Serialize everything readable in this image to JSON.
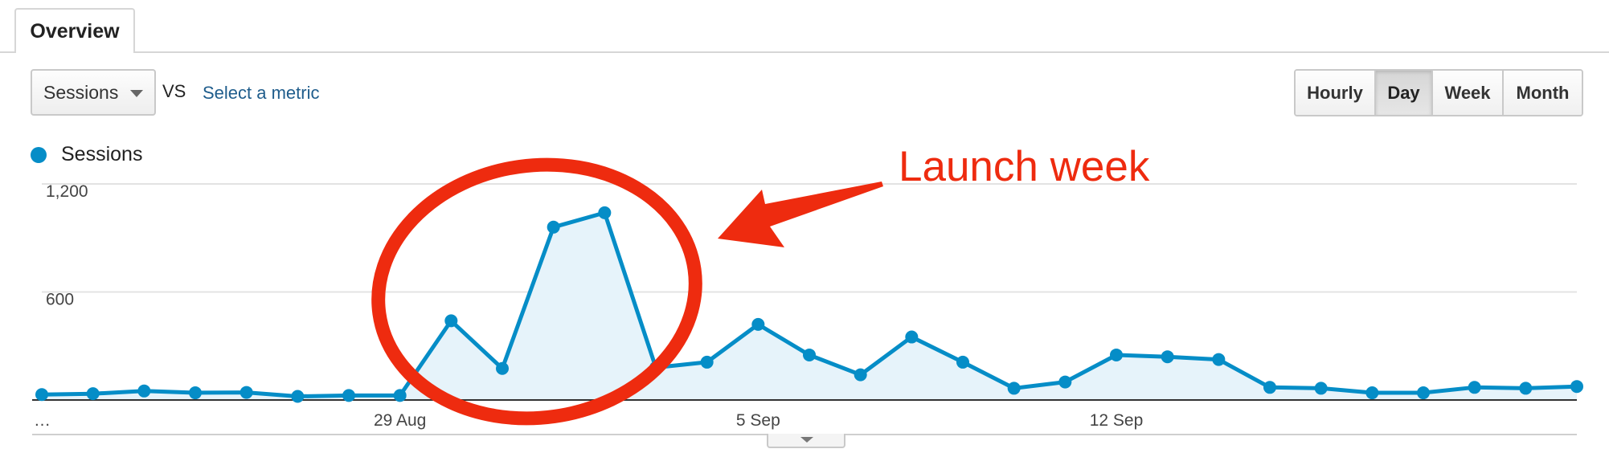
{
  "tabs": [
    {
      "label": "Overview",
      "active": true
    }
  ],
  "controls": {
    "metric_select": {
      "value": "Sessions"
    },
    "vs_label": "VS",
    "compare_link": "Select a metric",
    "granularity": [
      {
        "label": "Hourly",
        "active": false
      },
      {
        "label": "Day",
        "active": true
      },
      {
        "label": "Week",
        "active": false
      },
      {
        "label": "Month",
        "active": false
      }
    ]
  },
  "legend": {
    "label": "Sessions",
    "color": "#058dc7"
  },
  "annotation": {
    "text": "Launch week",
    "color": "#ee2b0f"
  },
  "chart_data": {
    "type": "area",
    "series": [
      {
        "name": "Sessions",
        "color": "#058dc7",
        "values": [
          30,
          35,
          50,
          40,
          42,
          20,
          25,
          25,
          440,
          175,
          960,
          1040,
          180,
          210,
          420,
          250,
          140,
          350,
          210,
          65,
          100,
          250,
          240,
          225,
          70,
          65,
          40,
          40,
          70,
          65,
          75
        ]
      }
    ],
    "x_tick_labels": [
      {
        "index": 0,
        "label": "…"
      },
      {
        "index": 7,
        "label": "29 Aug"
      },
      {
        "index": 14,
        "label": "5 Sep"
      },
      {
        "index": 21,
        "label": "12 Sep"
      }
    ],
    "yticks": [
      {
        "value": 1200,
        "label": "1,200"
      },
      {
        "value": 600,
        "label": "600"
      }
    ],
    "ylim": [
      0,
      1200
    ],
    "grid": true
  }
}
